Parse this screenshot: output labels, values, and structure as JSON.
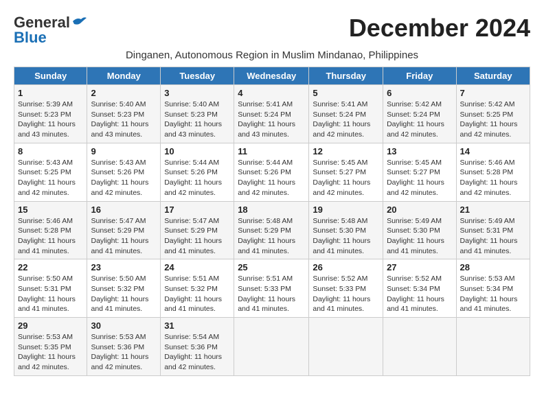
{
  "header": {
    "logo_general": "General",
    "logo_blue": "Blue",
    "month_year": "December 2024",
    "subtitle": "Dinganen, Autonomous Region in Muslim Mindanao, Philippines"
  },
  "weekdays": [
    "Sunday",
    "Monday",
    "Tuesday",
    "Wednesday",
    "Thursday",
    "Friday",
    "Saturday"
  ],
  "weeks": [
    [
      {
        "day": 1,
        "sunrise": "5:39 AM",
        "sunset": "5:23 PM",
        "daylight": "11 hours and 43 minutes."
      },
      {
        "day": 2,
        "sunrise": "5:40 AM",
        "sunset": "5:23 PM",
        "daylight": "11 hours and 43 minutes."
      },
      {
        "day": 3,
        "sunrise": "5:40 AM",
        "sunset": "5:23 PM",
        "daylight": "11 hours and 43 minutes."
      },
      {
        "day": 4,
        "sunrise": "5:41 AM",
        "sunset": "5:24 PM",
        "daylight": "11 hours and 43 minutes."
      },
      {
        "day": 5,
        "sunrise": "5:41 AM",
        "sunset": "5:24 PM",
        "daylight": "11 hours and 42 minutes."
      },
      {
        "day": 6,
        "sunrise": "5:42 AM",
        "sunset": "5:24 PM",
        "daylight": "11 hours and 42 minutes."
      },
      {
        "day": 7,
        "sunrise": "5:42 AM",
        "sunset": "5:25 PM",
        "daylight": "11 hours and 42 minutes."
      }
    ],
    [
      {
        "day": 8,
        "sunrise": "5:43 AM",
        "sunset": "5:25 PM",
        "daylight": "11 hours and 42 minutes."
      },
      {
        "day": 9,
        "sunrise": "5:43 AM",
        "sunset": "5:26 PM",
        "daylight": "11 hours and 42 minutes."
      },
      {
        "day": 10,
        "sunrise": "5:44 AM",
        "sunset": "5:26 PM",
        "daylight": "11 hours and 42 minutes."
      },
      {
        "day": 11,
        "sunrise": "5:44 AM",
        "sunset": "5:26 PM",
        "daylight": "11 hours and 42 minutes."
      },
      {
        "day": 12,
        "sunrise": "5:45 AM",
        "sunset": "5:27 PM",
        "daylight": "11 hours and 42 minutes."
      },
      {
        "day": 13,
        "sunrise": "5:45 AM",
        "sunset": "5:27 PM",
        "daylight": "11 hours and 42 minutes."
      },
      {
        "day": 14,
        "sunrise": "5:46 AM",
        "sunset": "5:28 PM",
        "daylight": "11 hours and 42 minutes."
      }
    ],
    [
      {
        "day": 15,
        "sunrise": "5:46 AM",
        "sunset": "5:28 PM",
        "daylight": "11 hours and 41 minutes."
      },
      {
        "day": 16,
        "sunrise": "5:47 AM",
        "sunset": "5:29 PM",
        "daylight": "11 hours and 41 minutes."
      },
      {
        "day": 17,
        "sunrise": "5:47 AM",
        "sunset": "5:29 PM",
        "daylight": "11 hours and 41 minutes."
      },
      {
        "day": 18,
        "sunrise": "5:48 AM",
        "sunset": "5:29 PM",
        "daylight": "11 hours and 41 minutes."
      },
      {
        "day": 19,
        "sunrise": "5:48 AM",
        "sunset": "5:30 PM",
        "daylight": "11 hours and 41 minutes."
      },
      {
        "day": 20,
        "sunrise": "5:49 AM",
        "sunset": "5:30 PM",
        "daylight": "11 hours and 41 minutes."
      },
      {
        "day": 21,
        "sunrise": "5:49 AM",
        "sunset": "5:31 PM",
        "daylight": "11 hours and 41 minutes."
      }
    ],
    [
      {
        "day": 22,
        "sunrise": "5:50 AM",
        "sunset": "5:31 PM",
        "daylight": "11 hours and 41 minutes."
      },
      {
        "day": 23,
        "sunrise": "5:50 AM",
        "sunset": "5:32 PM",
        "daylight": "11 hours and 41 minutes."
      },
      {
        "day": 24,
        "sunrise": "5:51 AM",
        "sunset": "5:32 PM",
        "daylight": "11 hours and 41 minutes."
      },
      {
        "day": 25,
        "sunrise": "5:51 AM",
        "sunset": "5:33 PM",
        "daylight": "11 hours and 41 minutes."
      },
      {
        "day": 26,
        "sunrise": "5:52 AM",
        "sunset": "5:33 PM",
        "daylight": "11 hours and 41 minutes."
      },
      {
        "day": 27,
        "sunrise": "5:52 AM",
        "sunset": "5:34 PM",
        "daylight": "11 hours and 41 minutes."
      },
      {
        "day": 28,
        "sunrise": "5:53 AM",
        "sunset": "5:34 PM",
        "daylight": "11 hours and 41 minutes."
      }
    ],
    [
      {
        "day": 29,
        "sunrise": "5:53 AM",
        "sunset": "5:35 PM",
        "daylight": "11 hours and 42 minutes."
      },
      {
        "day": 30,
        "sunrise": "5:53 AM",
        "sunset": "5:36 PM",
        "daylight": "11 hours and 42 minutes."
      },
      {
        "day": 31,
        "sunrise": "5:54 AM",
        "sunset": "5:36 PM",
        "daylight": "11 hours and 42 minutes."
      },
      null,
      null,
      null,
      null
    ]
  ]
}
